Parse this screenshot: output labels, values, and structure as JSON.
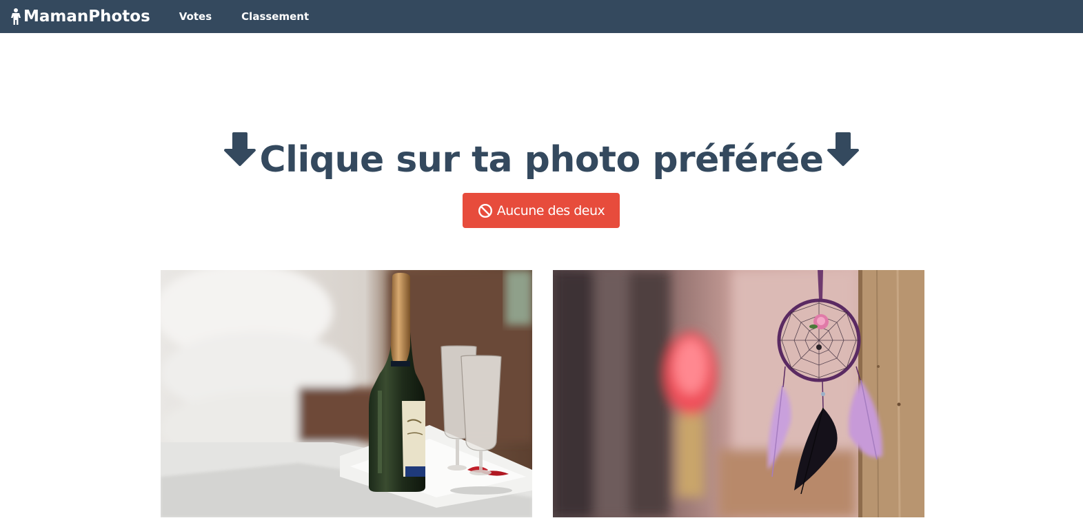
{
  "navbar": {
    "brand": "MamanPhotos",
    "brand_icon": "person-icon",
    "links": [
      {
        "label": "Votes"
      },
      {
        "label": "Classement"
      }
    ],
    "background": "#34495e"
  },
  "main": {
    "heading": "Clique sur ta photo préférée",
    "heading_icon": "arrow-down-icon",
    "none_button": {
      "label": "Aucune des deux",
      "icon": "ban-icon",
      "color": "#e74c3c"
    },
    "photos": [
      {
        "subject": "champagne-bottle-photo"
      },
      {
        "subject": "dreamcatcher-photo"
      }
    ]
  }
}
